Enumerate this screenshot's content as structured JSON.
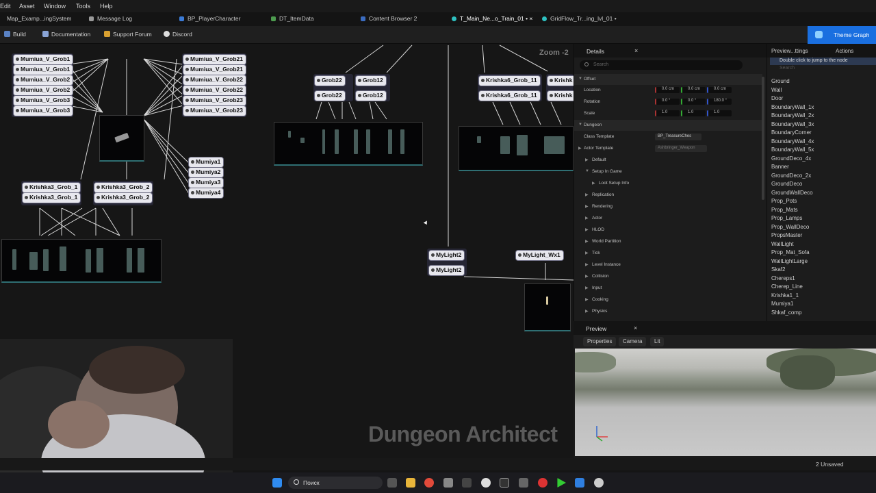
{
  "menu": [
    "Edit",
    "Asset",
    "Window",
    "Tools",
    "Help"
  ],
  "tabs": [
    "Map_Examp...ingSystem",
    "Message Log",
    "BP_PlayerCharacter",
    "DT_ItemData",
    "Content Browser 2",
    "T_Main_Ne...o_Train_01 • ×",
    "GridFlow_Tr...ing_lvl_01 •"
  ],
  "toolbar": {
    "build": "Build",
    "documentation": "Documentation",
    "support": "Support Forum",
    "discord": "Discord",
    "theme_graph": "Theme Graph"
  },
  "graph": {
    "zoom": "Zoom -2",
    "watermark": "Dungeon Architect",
    "nodes_left": [
      "Mumiua_V_Grob1",
      "Mumiua_V_Grob1",
      "Mumiua_V_Grob2",
      "Mumiua_V_Grob2",
      "Mumiua_V_Grob3",
      "Mumiua_V_Grob3"
    ],
    "nodes_right": [
      "Mumiua_V_Grob21",
      "Mumiua_V_Grob21",
      "Mumiua_V_Grob22",
      "Mumiua_V_Grob22",
      "Mumiua_V_Grob23",
      "Mumiua_V_Grob23"
    ],
    "nodes_mumiya": [
      "Mumiya1",
      "Mumiya2",
      "Mumiya3",
      "Mumiya4"
    ],
    "krishka3": [
      "Krishka3_Grob_1",
      "Krishka3_Grob_1",
      "Krishka3_Grob_2",
      "Krishka3_Grob_2"
    ],
    "grob": [
      "Grob22",
      "Grob12",
      "Grob22",
      "Grob12"
    ],
    "krishka6": [
      "Krishka6_Grob_11",
      "Krishka6_Grob_11",
      "Krishk",
      "Krishk"
    ],
    "lights": [
      "MyLight2",
      "MyLight2",
      "MyLight_Wx1"
    ]
  },
  "details": {
    "title": "Details",
    "close": "×",
    "search_placeholder": "Search",
    "offset": "Offset",
    "location": "Location",
    "location_vals": [
      "0.0 cm",
      "0.0 cm",
      "0.0 cm"
    ],
    "rotation": "Rotation",
    "rotation_vals": [
      "0.0 °",
      "0.0 °",
      "180.0 °"
    ],
    "scale": "Scale",
    "scale_vals": [
      "1.0",
      "1.0",
      "1.0"
    ],
    "dungeon": "Dungeon",
    "class_template": "Class Template",
    "class_template_val": "BP_TreasureChes",
    "actor_template": "Actor Template",
    "actor_template_val": "Ashbringer_Weapon",
    "sections": [
      "Default",
      "Setup In Game",
      "Loot Setup Info",
      "Replication",
      "Rendering",
      "Actor",
      "HLOD",
      "World Partition",
      "Tick",
      "Level Instance",
      "Collision",
      "Input",
      "Cooking",
      "Physics"
    ]
  },
  "rpanel": {
    "header_left": "Preview...ttings",
    "header_right": "Actions",
    "hint": "Double click to jump to the node",
    "search": "Search",
    "items": [
      "Ground",
      "Wall",
      "Door",
      "BoundaryWall_1x",
      "BoundaryWall_2x",
      "BoundaryWall_3x",
      "BoundaryCorner",
      "BoundaryWall_4x",
      "BoundaryWall_5x",
      "GroundDeco_4x",
      "Banner",
      "GroundDeco_2x",
      "GroundDeco",
      "GroundWallDeco",
      "Prop_Pots",
      "Prop_Mats",
      "Prop_Lamps",
      "Prop_WallDeco",
      "PropsMaster",
      "WallLight",
      "Prop_Mat_Sofa",
      "WallLightLarge",
      "Skaf2",
      "Chereps1",
      "Cherep_Line",
      "Krishka1_1",
      "Mumiya1",
      "Shkaf_comp"
    ]
  },
  "preview": {
    "title": "Preview",
    "close": "×",
    "properties": "Properties",
    "camera": "Camera",
    "lit": "Lit"
  },
  "status": {
    "unsaved": "2 Unsaved"
  },
  "taskbar": {
    "search": "Поиск"
  }
}
